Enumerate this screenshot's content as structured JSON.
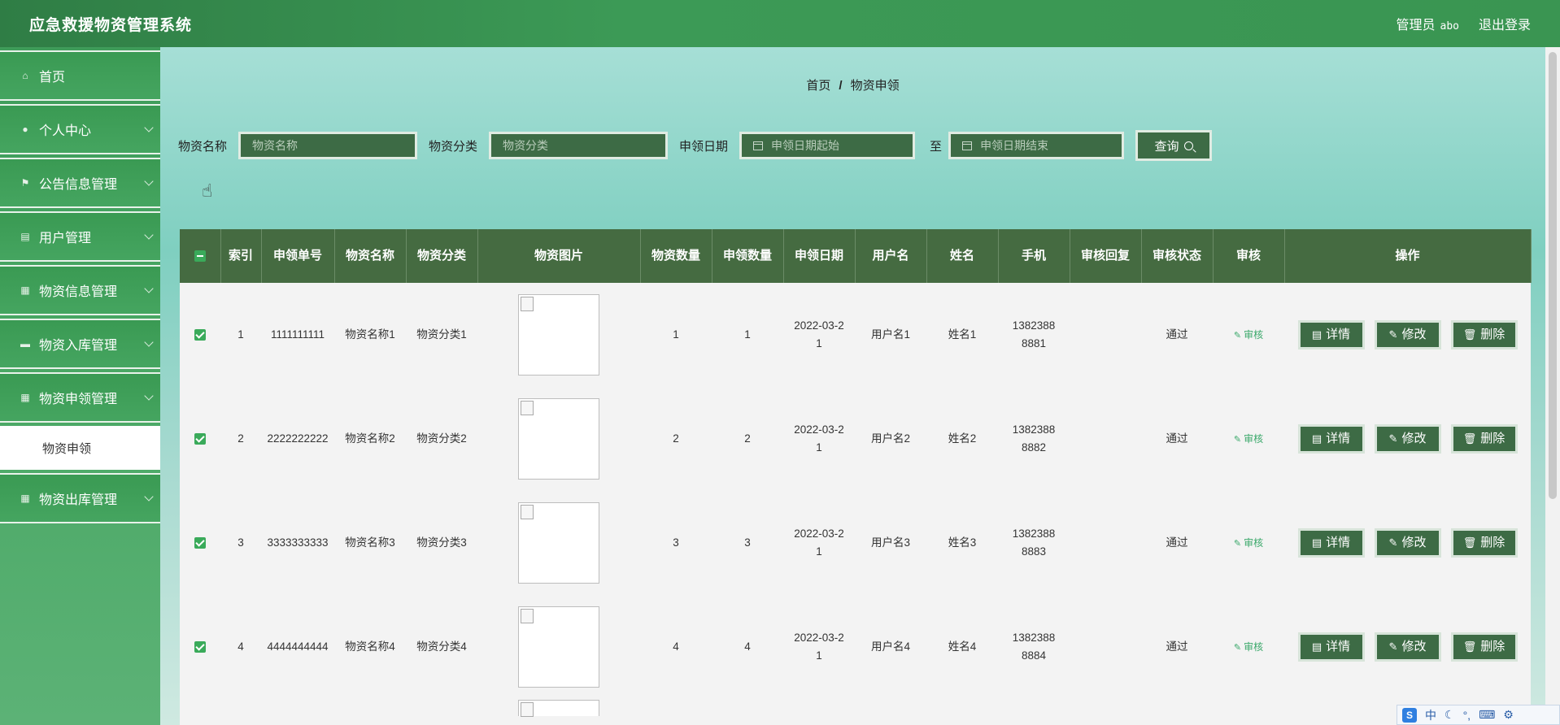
{
  "header": {
    "title": "应急救援物资管理系统",
    "role": "管理员",
    "username": "abo",
    "logout": "退出登录"
  },
  "sidebar": {
    "items": [
      {
        "label": "首页",
        "icon": "home-icon"
      },
      {
        "label": "个人中心",
        "icon": "user-icon"
      },
      {
        "label": "公告信息管理",
        "icon": "flag-icon"
      },
      {
        "label": "用户管理",
        "icon": "user-list-icon"
      },
      {
        "label": "物资信息管理",
        "icon": "grid-icon"
      },
      {
        "label": "物资入库管理",
        "icon": "message-icon"
      },
      {
        "label": "物资申领管理",
        "icon": "grid-icon"
      }
    ],
    "sub_item": "物资申领",
    "last_item": {
      "label": "物资出库管理",
      "icon": "grid-icon"
    }
  },
  "breadcrumb": {
    "home": "首页",
    "sep": "/",
    "current": "物资申领"
  },
  "search": {
    "name_label": "物资名称",
    "name_placeholder": "物资名称",
    "category_label": "物资分类",
    "category_placeholder": "物资分类",
    "date_label": "申领日期",
    "date_start_placeholder": "申领日期起始",
    "to": "至",
    "date_end_placeholder": "申领日期结束",
    "query_button": "查询"
  },
  "table": {
    "headers": [
      "索引",
      "申领单号",
      "物资名称",
      "物资分类",
      "物资图片",
      "物资数量",
      "申领数量",
      "申领日期",
      "用户名",
      "姓名",
      "手机",
      "审核回复",
      "审核状态",
      "审核",
      "操作"
    ],
    "rows": [
      {
        "index": "1",
        "order_no": "1111111111",
        "name": "物资名称1",
        "category": "物资分类1",
        "qty": "1",
        "apply_qty": "1",
        "date": "2022-03-21",
        "username": "用户名1",
        "realname": "姓名1",
        "phone": "13823888881",
        "reply": "",
        "status": "通过"
      },
      {
        "index": "2",
        "order_no": "2222222222",
        "name": "物资名称2",
        "category": "物资分类2",
        "qty": "2",
        "apply_qty": "2",
        "date": "2022-03-21",
        "username": "用户名2",
        "realname": "姓名2",
        "phone": "13823888882",
        "reply": "",
        "status": "通过"
      },
      {
        "index": "3",
        "order_no": "3333333333",
        "name": "物资名称3",
        "category": "物资分类3",
        "qty": "3",
        "apply_qty": "3",
        "date": "2022-03-21",
        "username": "用户名3",
        "realname": "姓名3",
        "phone": "13823888883",
        "reply": "",
        "status": "通过"
      },
      {
        "index": "4",
        "order_no": "4444444444",
        "name": "物资名称4",
        "category": "物资分类4",
        "qty": "4",
        "apply_qty": "4",
        "date": "2022-03-21",
        "username": "用户名4",
        "realname": "姓名4",
        "phone": "13823888884",
        "reply": "",
        "status": "通过"
      }
    ],
    "audit_link": "审核",
    "actions": {
      "detail": "详情",
      "edit": "修改",
      "delete": "删除"
    }
  },
  "ime": {
    "mode": "中"
  },
  "colors": {
    "header": "#3a9552",
    "sidebar": "#45a560",
    "table_header": "#456b41",
    "button": "#3d6b45"
  }
}
